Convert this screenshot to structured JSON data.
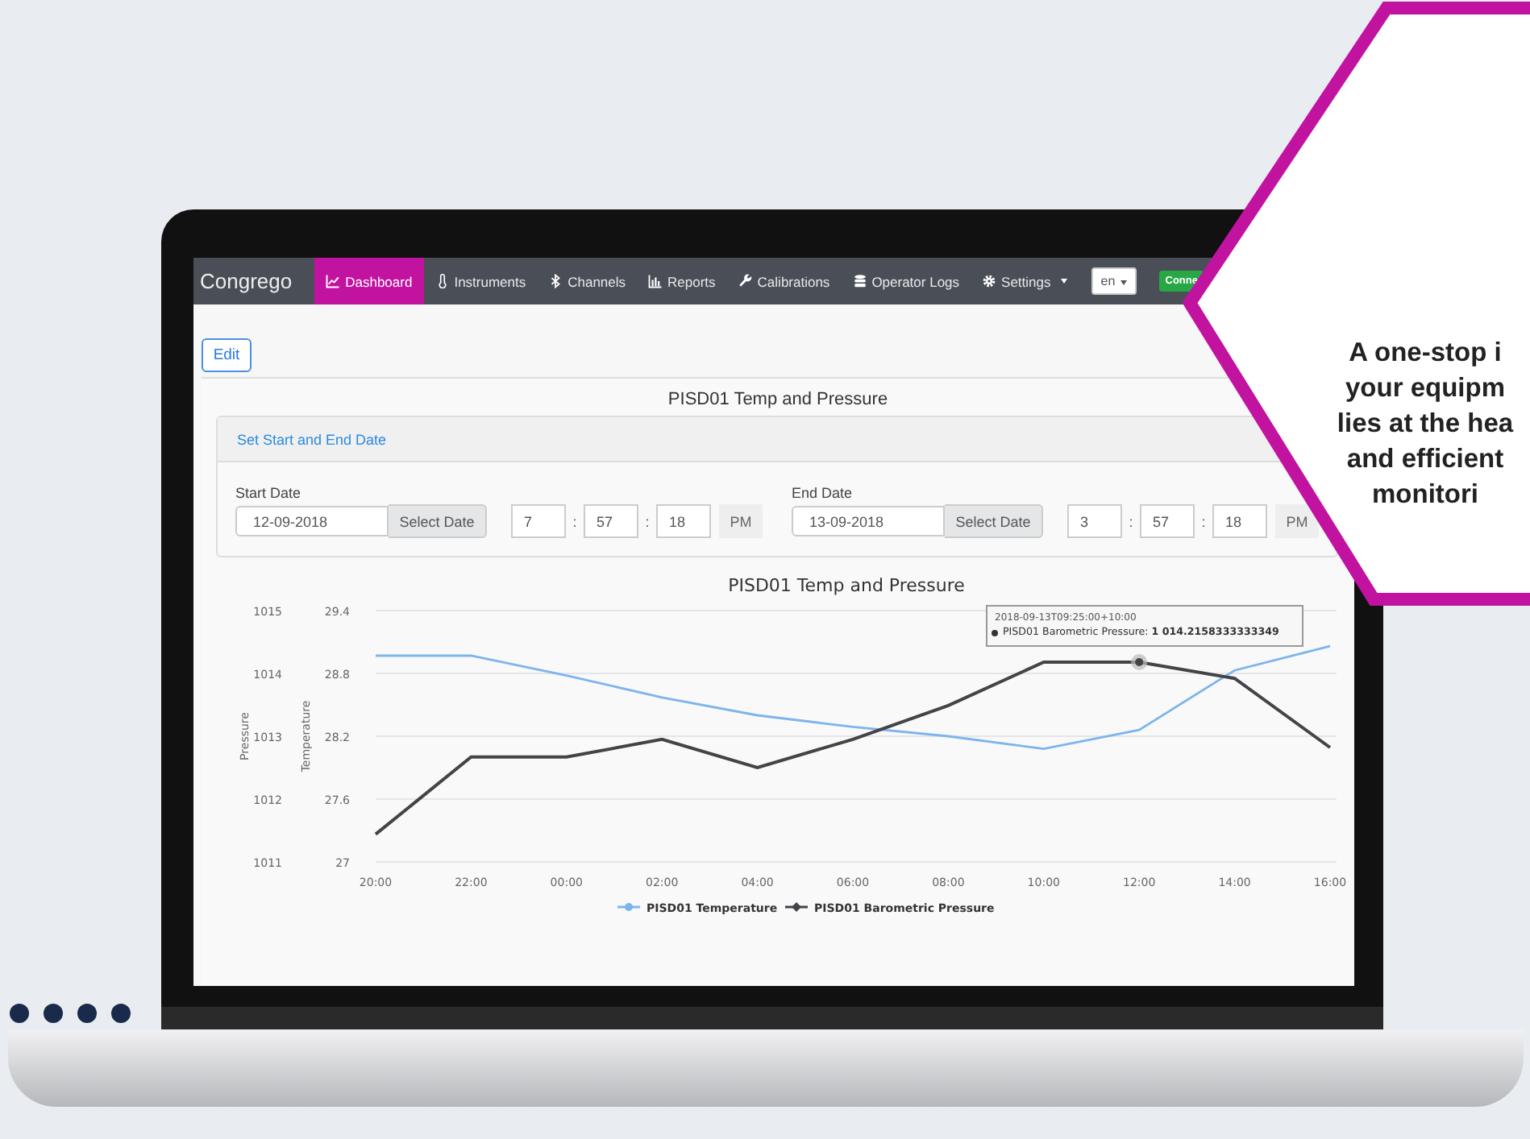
{
  "navbar": {
    "brand": "Congrego",
    "items": [
      {
        "label": "Dashboard",
        "selected": true
      },
      {
        "label": "Instruments",
        "selected": false
      },
      {
        "label": "Channels",
        "selected": false
      },
      {
        "label": "Reports",
        "selected": false
      },
      {
        "label": "Calibrations",
        "selected": false
      },
      {
        "label": "Operator Logs",
        "selected": false
      },
      {
        "label": "Settings",
        "selected": false,
        "dropdown": true
      }
    ],
    "language": "en",
    "status_badge": "Conne"
  },
  "edit_button": "Edit",
  "widget": {
    "title": "PISD01 Temp and Pressure",
    "date_panel": {
      "heading": "Set Start and End Date",
      "groups": [
        {
          "label": "Start Date",
          "date": "12-09-2018",
          "button": "Select Date",
          "hour": "7",
          "sep1": ":",
          "minute": "57",
          "sep2": ":",
          "second": "18",
          "period": "PM"
        },
        {
          "label": "End Date",
          "date": "13-09-2018",
          "button": "Select Date",
          "hour": "3",
          "sep1": ":",
          "minute": "57",
          "sep2": ":",
          "second": "18",
          "period": "PM"
        }
      ]
    },
    "chart": {
      "chart_data": {
        "type": "line",
        "title": "PISD01 Temp and Pressure",
        "ylabel": "Temperature",
        "y2label": "Pressure",
        "categories": [
          "20:00",
          "22:00",
          "00:00",
          "02:00",
          "04:00",
          "06:00",
          "08:00",
          "10:00",
          "12:00",
          "14:00",
          "16:00"
        ],
        "grid": true,
        "legend": "bottom",
        "ylim": [
          27,
          29.4
        ],
        "yticks": [
          {
            "value": 27,
            "label": "27"
          },
          {
            "value": 27.6,
            "label": "27.6"
          },
          {
            "value": 28.2,
            "label": "28.2"
          },
          {
            "value": 28.8,
            "label": "28.8"
          },
          {
            "value": 29.4,
            "label": "29.4"
          }
        ],
        "y2lim": [
          1011,
          1015
        ],
        "y2ticks": [
          {
            "value": 1011,
            "label": "1011"
          },
          {
            "value": 1012,
            "label": "1012"
          },
          {
            "value": 1013,
            "label": "1013"
          },
          {
            "value": 1014,
            "label": "1014"
          },
          {
            "value": 1015,
            "label": "1015"
          }
        ],
        "series": [
          {
            "name": "PISD01 Temperature",
            "color": "#7cb5ec",
            "axis": "y",
            "values": [
              28.97,
              28.97,
              28.78,
              28.57,
              28.4,
              28.29,
              28.2,
              28.08,
              28.26,
              28.83,
              29.06
            ]
          },
          {
            "name": "PISD01 Barometric Pressure",
            "color": "#434348",
            "axis": "y2",
            "values": [
              1011.44,
              1012.67,
              1012.67,
              1012.95,
              1012.5,
              1012.95,
              1013.49,
              1014.18,
              1014.18,
              1013.92,
              1012.82
            ]
          }
        ]
      },
      "tooltip": {
        "time": "2018-09-13T09:25:00+10:00",
        "text": "PISD01 Barometric Pressure: **1 014.2158333333349**"
      }
    }
  },
  "callout": {
    "lines": [
      "A one-stop i",
      "your equipm",
      "lies at the hea",
      "and efficient",
      "monitori"
    ]
  }
}
